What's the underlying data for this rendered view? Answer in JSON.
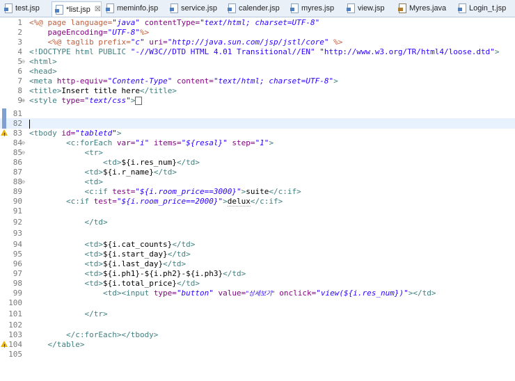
{
  "tabs": [
    {
      "label": "test.jsp",
      "icon": "jsp-file-icon",
      "active": false
    },
    {
      "label": "*list.jsp",
      "icon": "jsp-file-icon",
      "active": true
    },
    {
      "label": "meminfo.jsp",
      "icon": "jsp-file-icon",
      "active": false
    },
    {
      "label": "service.jsp",
      "icon": "jsp-file-icon",
      "active": false
    },
    {
      "label": "calender.jsp",
      "icon": "jsp-file-icon",
      "active": false
    },
    {
      "label": "myres.jsp",
      "icon": "jsp-file-icon",
      "active": false
    },
    {
      "label": "view.jsp",
      "icon": "jsp-file-icon",
      "active": false
    },
    {
      "label": "Myres.java",
      "icon": "java-file-icon",
      "active": false
    },
    {
      "label": "Login_t.jsp",
      "icon": "jsp-file-icon",
      "active": false
    }
  ],
  "close_glyph": "☒",
  "editor": {
    "line_numbers": [
      "1",
      "2",
      "3",
      "4",
      "5",
      "6",
      "7",
      "8",
      "9",
      "81",
      "82",
      "83",
      "84",
      "85",
      "86",
      "87",
      "88",
      "89",
      "90",
      "91",
      "92",
      "93",
      "94",
      "95",
      "96",
      "97",
      "98",
      "99",
      "100",
      "101",
      "102",
      "103",
      "104",
      "105"
    ],
    "lines": {
      "l1": [
        "<%@ page language=",
        "\"java\"",
        " contentType=",
        "\"text/html; charset=UTF-8\""
      ],
      "l2": [
        "    pageEncoding=",
        "\"UTF-8\"",
        "%>"
      ],
      "l3": [
        "    <%@ taglib prefix=",
        "\"c\"",
        " uri=",
        "\"http://java.sun.com/jsp/jstl/core\"",
        " %>"
      ],
      "l4": [
        "<!DOCTYPE html PUBLIC ",
        "\"-//W3C//DTD HTML 4.01 Transitional//EN\"",
        " ",
        "\"http://www.w3.org/TR/html4/loose.dtd\"",
        ">"
      ],
      "l5": [
        "<html>"
      ],
      "l6": [
        "<head>"
      ],
      "l7": [
        "<meta ",
        "http-equiv=",
        "\"Content-Type\"",
        " content=",
        "\"text/html; charset=UTF-8\"",
        ">"
      ],
      "l8": [
        "<title>",
        "Insert title here",
        "</title>"
      ],
      "l9": [
        "<style ",
        "type=",
        "\"text/css\"",
        ">"
      ],
      "l83": [
        "<tbody ",
        "id=",
        "\"tabletd\"",
        ">"
      ],
      "l84": [
        "        <c:forEach ",
        "var=",
        "\"i\"",
        " items=",
        "\"${resal}\"",
        " step=",
        "\"1\"",
        ">"
      ],
      "l85": [
        "            <tr>"
      ],
      "l86": [
        "                <td>",
        "${i.res_num}",
        "</td>"
      ],
      "l87": [
        "            <td>",
        "${i.r_name}",
        "</td>"
      ],
      "l88": [
        "            <td>"
      ],
      "l89": [
        "            <c:if ",
        "test=",
        "\"${i.room_price==3000}\"",
        ">",
        "suite",
        "</c:if>"
      ],
      "l90": [
        "        <c:if ",
        "test=",
        "\"${i.room_price==2000}\"",
        ">",
        "delux",
        "</c:if>"
      ],
      "l92": [
        "            </td>"
      ],
      "l94": [
        "            <td>",
        "${i.cat_counts}",
        "</td>"
      ],
      "l95": [
        "            <td>",
        "${i.start_day}",
        "</td>"
      ],
      "l96": [
        "            <td>",
        "${i.last_day}",
        "</td>"
      ],
      "l97": [
        "            <td>",
        "${i.ph1}-${i.ph2}-${i.ph3}",
        "</td>"
      ],
      "l98": [
        "            <td>",
        "${i.total_price}",
        "</td>"
      ],
      "l99": [
        "                <td><input ",
        "type=",
        "\"button\"",
        " value=",
        "\"상세보기\"",
        " onclick=",
        "\"view(${i.res_num})\"",
        "></td>"
      ],
      "l101": [
        "            </tr>"
      ],
      "l103": [
        "        </c:forEach></tbody>"
      ],
      "l104": [
        "    </table>"
      ]
    }
  }
}
